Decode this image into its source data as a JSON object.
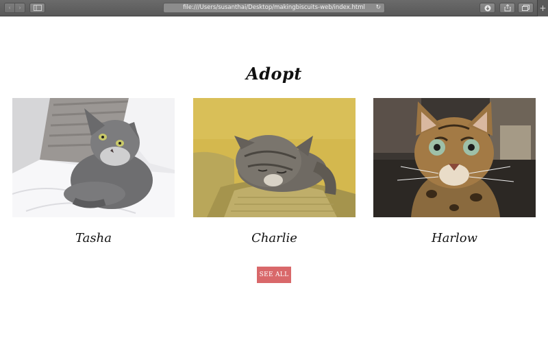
{
  "browser": {
    "url": "file:///Users/susanthai/Desktop/makingbiscuits-web/index.html",
    "icons": {
      "back": "chevron-left-icon",
      "forward": "chevron-right-icon",
      "sidebar": "sidebar-icon",
      "reload": "reload-icon",
      "downloads": "download-icon",
      "share": "share-icon",
      "tabs": "tabs-icon",
      "new_tab": "plus-icon"
    }
  },
  "page": {
    "title": "Adopt",
    "cats": [
      {
        "name": "Tasha",
        "photo": "gray longhair cat on white bedding"
      },
      {
        "name": "Charlie",
        "photo": "tabby cat sleeping on sofa arm"
      },
      {
        "name": "Harlow",
        "photo": "bengal cat close-up"
      }
    ],
    "see_all_label": "SEE ALL"
  },
  "colors": {
    "button": "#d9686a",
    "toolbar": "#5f5f5f"
  }
}
